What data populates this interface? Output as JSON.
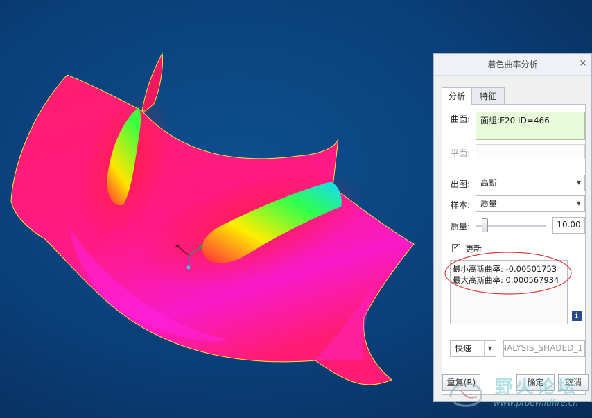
{
  "dialog": {
    "title": "着色曲率分析",
    "close_glyph": "×",
    "tabs": [
      {
        "label": "分析"
      },
      {
        "label": "特征"
      }
    ],
    "surface_label": "曲面:",
    "surface_value": "面组:F20 ID=466",
    "plane_label": "平面:",
    "output_label": "出图:",
    "output_value": "高斯",
    "sample_label": "样本:",
    "sample_value": "质量",
    "quality_label": "质量:",
    "quality_value": "10.00",
    "quality_level": 0.1,
    "update_label": "更新",
    "update_checked": true,
    "results": {
      "min_line": "最小高斯曲率: -0.00501753",
      "max_line": "最大高斯曲率: 0.000567934"
    },
    "info_glyph": "i",
    "mode_value": "快速",
    "analysis_name": "NALYSIS_SHADED_1",
    "buttons": {
      "repeat": "重复(R)",
      "ok": "确定",
      "cancel": "取消"
    }
  },
  "watermark": {
    "text": "野火论坛",
    "url": "www.proewildfire.cn"
  },
  "colors": {
    "background": "#0a3f78",
    "surface_main": "#ff1a78",
    "highlight_yellow": "#f6ff00",
    "highlight_green": "#28ff5a",
    "highlight_cyan": "#1ee6ff",
    "ellipse": "#d93a3a"
  }
}
